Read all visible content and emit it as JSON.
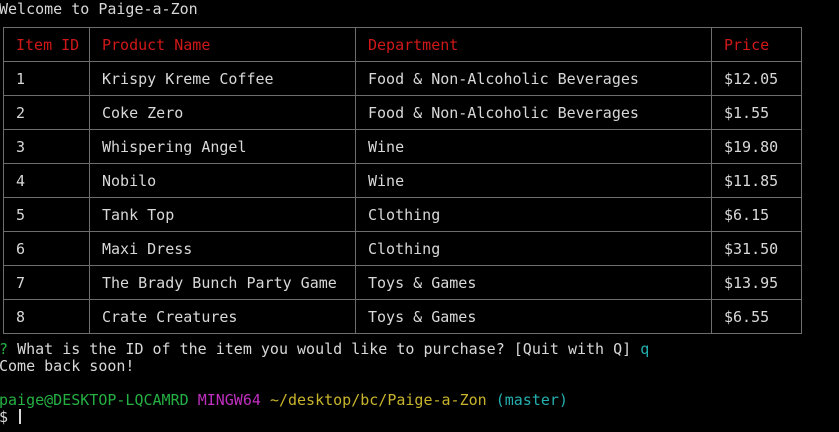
{
  "welcome": "Welcome to Paige-a-Zon",
  "table": {
    "headers": [
      "Item ID",
      "Product Name",
      "Department",
      "Price"
    ],
    "rows": [
      {
        "id": "1",
        "name": "Krispy Kreme Coffee",
        "department": "Food & Non-Alcoholic Beverages",
        "price": "$12.05"
      },
      {
        "id": "2",
        "name": "Coke Zero",
        "department": "Food & Non-Alcoholic Beverages",
        "price": "$1.55"
      },
      {
        "id": "3",
        "name": "Whispering Angel",
        "department": "Wine",
        "price": "$19.80"
      },
      {
        "id": "4",
        "name": "Nobilo",
        "department": "Wine",
        "price": "$11.85"
      },
      {
        "id": "5",
        "name": "Tank Top",
        "department": "Clothing",
        "price": "$6.15"
      },
      {
        "id": "6",
        "name": "Maxi Dress",
        "department": "Clothing",
        "price": "$31.50"
      },
      {
        "id": "7",
        "name": "The Brady Bunch Party Game",
        "department": "Toys & Games",
        "price": "$13.95"
      },
      {
        "id": "8",
        "name": "Crate Creatures",
        "department": "Toys & Games",
        "price": "$6.55"
      }
    ]
  },
  "prompt": {
    "marker": "?",
    "question": "What is the ID of the item you would like to purchase? [Quit with Q]",
    "answer": "q"
  },
  "farewell": "Come back soon!",
  "shell": {
    "user_host": "paige@DESKTOP-LQCAMRD",
    "system": "MINGW64",
    "path": "~/desktop/bc/Paige-a-Zon",
    "branch": "(master)",
    "prompt_symbol": "$"
  },
  "colors": {
    "background": "#000000",
    "text": "#d8d8d8",
    "header": "#d01818",
    "green": "#25b043",
    "cyan": "#25b0b0",
    "magenta": "#c02fc0",
    "yellow": "#c8b42c"
  }
}
